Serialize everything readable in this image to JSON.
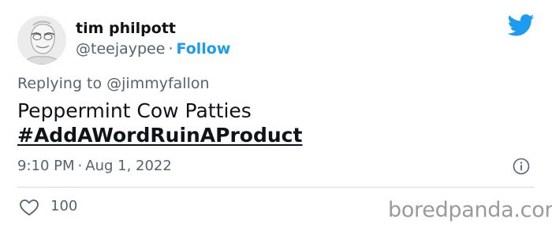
{
  "user": {
    "display_name": "tim philpott",
    "handle": "@teejaypee",
    "follow_label": "Follow"
  },
  "reply": {
    "prefix": "Replying to ",
    "mention": "@jimmyfallon"
  },
  "tweet": {
    "line1": "Peppermint Cow Patties",
    "hashtag": "#AddAWordRuinAProduct"
  },
  "meta": {
    "time": "9:10 PM",
    "date": "Aug 1, 2022"
  },
  "stats": {
    "likes": "100"
  },
  "watermark": "boredpanda.com",
  "colors": {
    "twitter_blue": "#1d9bf0",
    "secondary_text": "#536471",
    "primary_text": "#0f1419"
  },
  "icons": [
    "twitter-bird-icon",
    "info-icon",
    "heart-icon"
  ]
}
